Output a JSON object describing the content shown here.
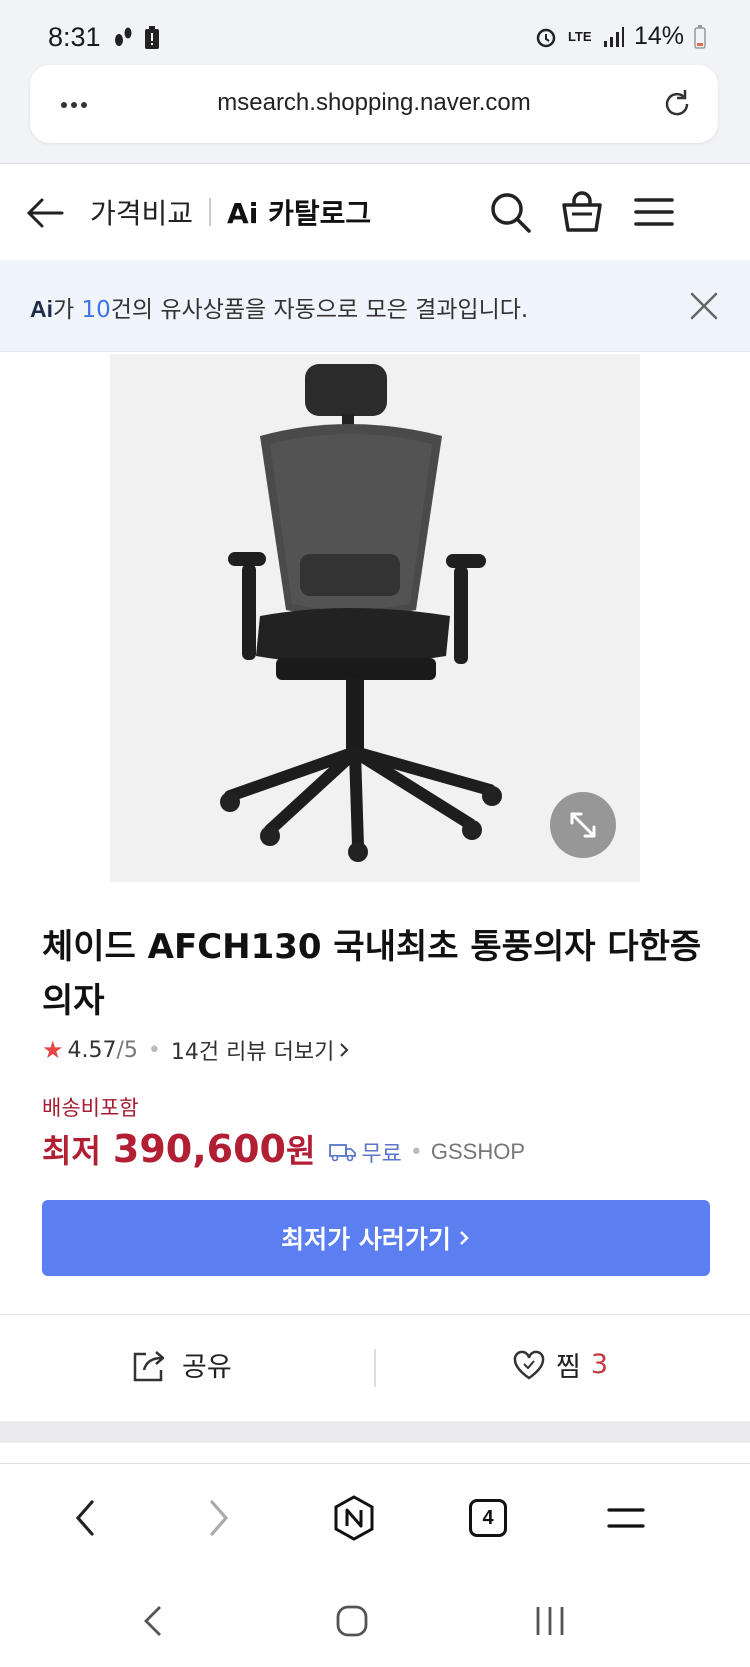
{
  "status_bar": {
    "time": "8:31",
    "network": "LTE",
    "battery": "14%"
  },
  "url_bar": {
    "url": "msearch.shopping.naver.com"
  },
  "header": {
    "title": "가격비교",
    "subtitle": "Ai 카탈로그"
  },
  "ai_banner": {
    "logo": "Ai",
    "prefix": "가 ",
    "count": "10",
    "text": "건의 유사상품을 자동으로 모은 결과입니다."
  },
  "product": {
    "title": "체이드 AFCH130 국내최초 통풍의자 다한증 의자",
    "rating": "4.57",
    "rating_max": "/5",
    "review_link": "14건 리뷰 더보기",
    "shipping_label": "배송비포함",
    "price_label": "최저",
    "price": "390,600",
    "price_unit": "원",
    "delivery": "무료",
    "mall": "GSSHOP",
    "buy_button": "최저가 사러가기"
  },
  "actions": {
    "share_label": "공유",
    "like_label": "찜",
    "like_count": "3"
  },
  "browser_nav": {
    "tab_count": "4"
  },
  "colors": {
    "accent_blue": "#5b7ff0",
    "price_red": "#b21e34",
    "banner_bg": "#f0f4fb"
  }
}
